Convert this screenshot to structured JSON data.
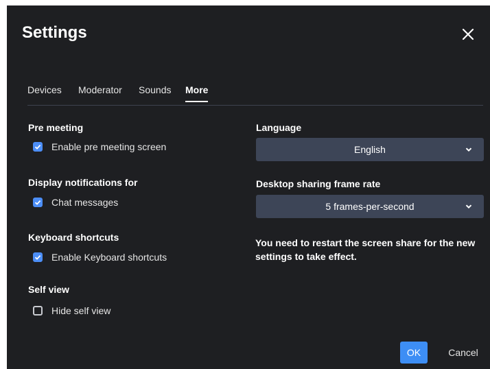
{
  "dialog": {
    "title": "Settings",
    "close_icon": "close-icon"
  },
  "tabs": [
    {
      "label": "Devices",
      "active": false
    },
    {
      "label": "Moderator",
      "active": false
    },
    {
      "label": "Sounds",
      "active": false
    },
    {
      "label": "More",
      "active": true
    }
  ],
  "left": {
    "pre_meeting": {
      "title": "Pre meeting",
      "option": "Enable pre meeting screen",
      "checked": true
    },
    "notifications": {
      "title": "Display notifications for",
      "option": "Chat messages",
      "checked": true
    },
    "keyboard": {
      "title": "Keyboard shortcuts",
      "option": "Enable Keyboard shortcuts",
      "checked": true
    },
    "self_view": {
      "title": "Self view",
      "option": "Hide self view",
      "checked": false
    }
  },
  "right": {
    "language": {
      "title": "Language",
      "value": "English"
    },
    "frame_rate": {
      "title": "Desktop sharing frame rate",
      "value": "5 frames-per-second"
    },
    "note": "You need to restart the screen share for the new settings to take effect."
  },
  "footer": {
    "ok_label": "OK",
    "cancel_label": "Cancel"
  },
  "colors": {
    "background": "#1e1f22",
    "accent": "#4c8ef7",
    "select_bg": "#3d4557",
    "primary_button": "#3d8ef5"
  }
}
